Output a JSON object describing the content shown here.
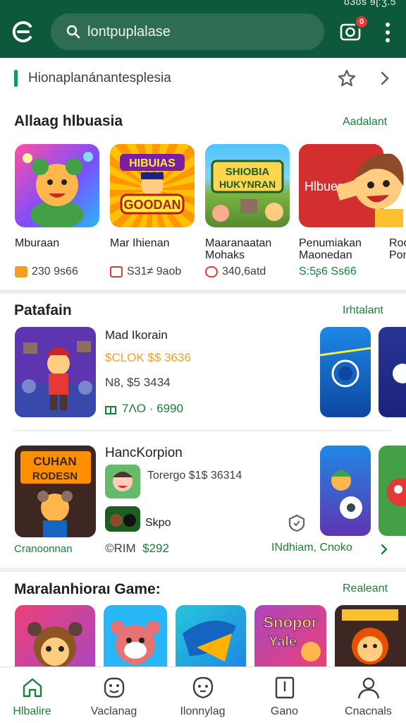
{
  "status_bar": {
    "text": "ʊ3ʊs  ɘɭ:ʒ.5"
  },
  "header": {
    "search_placeholder": "lontpuplalase",
    "camera_badge": "0",
    "icons": [
      "store-logo-icon",
      "search-icon",
      "camera-icon",
      "more-vert-icon"
    ]
  },
  "promo": {
    "text": "Hionaplanánantesplesia"
  },
  "section1": {
    "title": "Allaag hlbuasia",
    "link": "Aadalant",
    "games": [
      {
        "name": "Mburaan",
        "name2": "",
        "price": "230 9s66",
        "price_color": "#3c4043",
        "icon_color": "#f0a020"
      },
      {
        "name": "Mar Ihienan",
        "name2": "",
        "price": "S31≠ 9aob",
        "price_color": "#3c4043",
        "icon_color": "#e53935"
      },
      {
        "name": "Maaranaatan",
        "name2": "Mohaks",
        "price": "340,6atd",
        "price_color": "#3c4043",
        "icon_color": "#e53935"
      },
      {
        "name": "Penumiakan",
        "name2": "Maonedan",
        "price": "S:5ʂ6 Ss66",
        "price_color": "#188038",
        "icon_color": "#188038"
      },
      {
        "name": "Roo",
        "name2": "Pon",
        "price": "",
        "price_color": "#3c4043",
        "icon_color": "#f0a020"
      }
    ]
  },
  "section2": {
    "title": "Patafain",
    "link": "Irhtalant",
    "item1": {
      "name": "Mad Ikorain",
      "line2": "$CLOK $$ 3636",
      "line3": "N8, $5 3434",
      "line4": "7ɅO · 6990"
    },
    "item2": {
      "name": "HancKorpion",
      "line2": "Torergo $1$ 36314",
      "line3": "Skpo",
      "caption": "Cranoonnan",
      "price_prefix": "©RIM",
      "price": "$292",
      "more_link": "INdhiam, Cnoko"
    }
  },
  "section3": {
    "title": "Maralanhioraı Game:",
    "link": "Realeant"
  },
  "bottom_nav": [
    {
      "label": "Hlbalire",
      "icon": "home-icon",
      "active": true
    },
    {
      "label": "Vaclanag",
      "icon": "games-icon",
      "active": false
    },
    {
      "label": "Ilonnylag",
      "icon": "apps-icon",
      "active": false
    },
    {
      "label": "Gano",
      "icon": "books-icon",
      "active": false
    },
    {
      "label": "Cnacnals",
      "icon": "profile-icon",
      "active": false
    }
  ]
}
